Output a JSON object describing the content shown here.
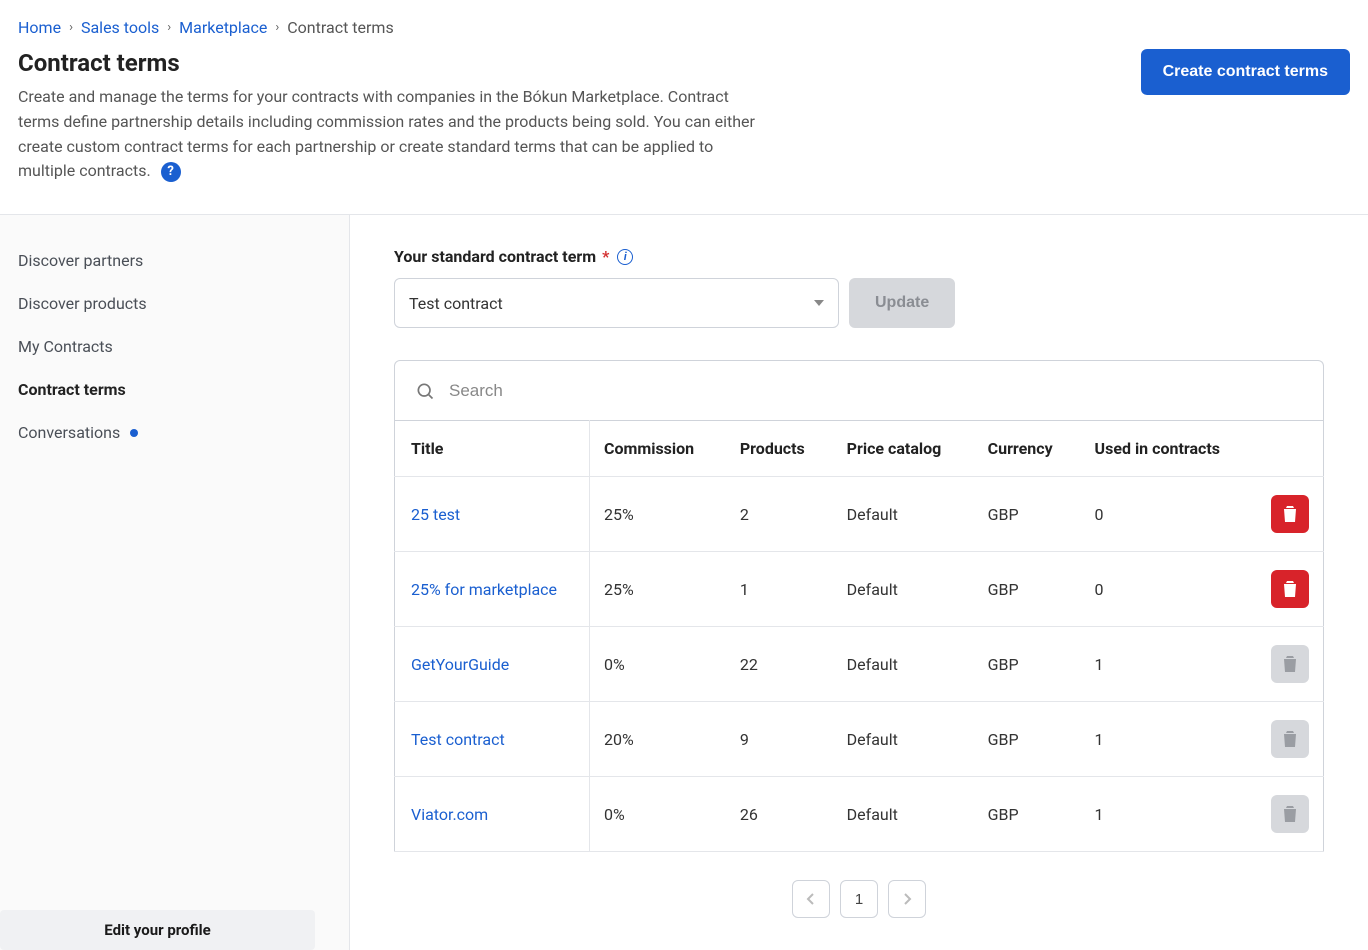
{
  "breadcrumb": {
    "items": [
      "Home",
      "Sales tools",
      "Marketplace",
      "Contract terms"
    ]
  },
  "header": {
    "title": "Contract terms",
    "description": "Create and manage the terms for your contracts with companies in the Bókun Marketplace. Contract terms define partnership details including commission rates and the products being sold. You can either create custom contract terms for each partnership or create standard terms that can be applied to multiple contracts.",
    "create_button": "Create contract terms"
  },
  "sidebar": {
    "items": [
      {
        "label": "Discover partners",
        "active": false,
        "dot": false
      },
      {
        "label": "Discover products",
        "active": false,
        "dot": false
      },
      {
        "label": "My Contracts",
        "active": false,
        "dot": false
      },
      {
        "label": "Contract terms",
        "active": true,
        "dot": false
      },
      {
        "label": "Conversations",
        "active": false,
        "dot": true
      }
    ],
    "footer": "Edit your profile"
  },
  "main": {
    "standard_label": "Your standard contract term",
    "selected_contract": "Test contract",
    "update_button": "Update",
    "search_placeholder": "Search",
    "columns": [
      "Title",
      "Commission",
      "Products",
      "Price catalog",
      "Currency",
      "Used in contracts"
    ],
    "rows": [
      {
        "title": "25 test",
        "commission": "25%",
        "products": "2",
        "catalog": "Default",
        "currency": "GBP",
        "used": "0",
        "deletable": true
      },
      {
        "title": "25% for marketplace",
        "commission": "25%",
        "products": "1",
        "catalog": "Default",
        "currency": "GBP",
        "used": "0",
        "deletable": true
      },
      {
        "title": "GetYourGuide",
        "commission": "0%",
        "products": "22",
        "catalog": "Default",
        "currency": "GBP",
        "used": "1",
        "deletable": false
      },
      {
        "title": "Test contract",
        "commission": "20%",
        "products": "9",
        "catalog": "Default",
        "currency": "GBP",
        "used": "1",
        "deletable": false
      },
      {
        "title": "Viator.com",
        "commission": "0%",
        "products": "26",
        "catalog": "Default",
        "currency": "GBP",
        "used": "1",
        "deletable": false
      }
    ],
    "pager": {
      "current": "1"
    }
  }
}
